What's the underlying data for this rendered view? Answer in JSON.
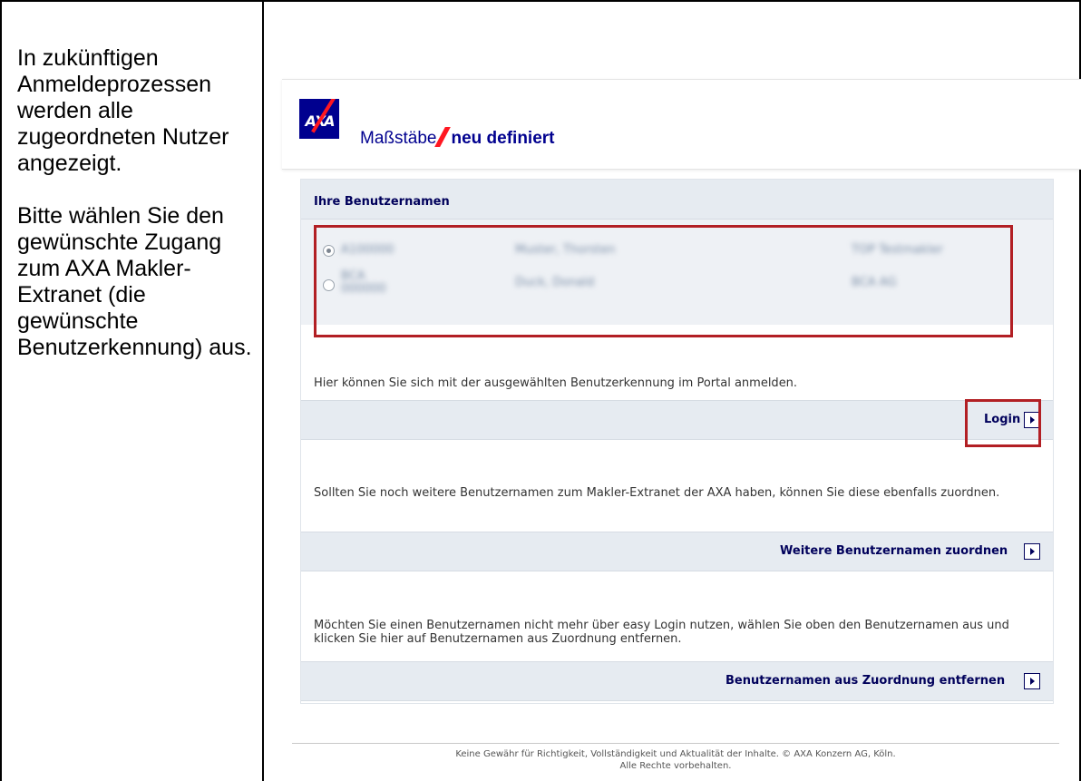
{
  "instructions": {
    "paragraph_1": "In zukünftigen Anmeldeprozessen werden alle zugeordneten Nutzer angezeigt.",
    "paragraph_2": "Bitte wählen Sie den gewünschte Zugang zum AXA Makler-Extranet (die gewünschte Benutzerkennung) aus."
  },
  "header": {
    "logo_text": "AXA",
    "slogan_part1": "Maßstäbe",
    "slogan_part2": "neu definiert"
  },
  "panel": {
    "title": "Ihre Benutzernamen",
    "users": [
      {
        "selected": true,
        "id": "A100000",
        "name": "Muster, Thorsten",
        "agency": "TOP Testmakler"
      },
      {
        "selected": false,
        "id": "BCA 000000",
        "name": "Duck, Donald",
        "agency": "BCA AG"
      }
    ],
    "login_hint": "Hier können Sie sich mit der ausgewählten Benutzerkennung im Portal anmelden.",
    "login_label": "Login",
    "more_hint": "Sollten Sie noch weitere Benutzernamen zum Makler-Extranet der AXA haben, können Sie diese ebenfalls zuordnen.",
    "more_label": "Weitere Benutzernamen zuordnen",
    "remove_hint": "Möchten Sie einen Benutzernamen nicht mehr über easy Login nutzen, wählen Sie oben den Benutzernamen aus und klicken Sie hier auf Benutzernamen aus Zuordnung entfernen.",
    "remove_label": "Benutzernamen aus Zuordnung entfernen"
  },
  "footer": {
    "line1": "Keine Gewähr für Richtigkeit, Vollständigkeit und Aktualität der Inhalte. © AXA Konzern AG, Köln.",
    "line2": "Alle Rechte vorbehalten."
  },
  "colors": {
    "axa_blue": "#00008f",
    "axa_red": "#ff1721",
    "highlight_red": "#b21f24",
    "panel_bg": "#e6ebf1"
  }
}
